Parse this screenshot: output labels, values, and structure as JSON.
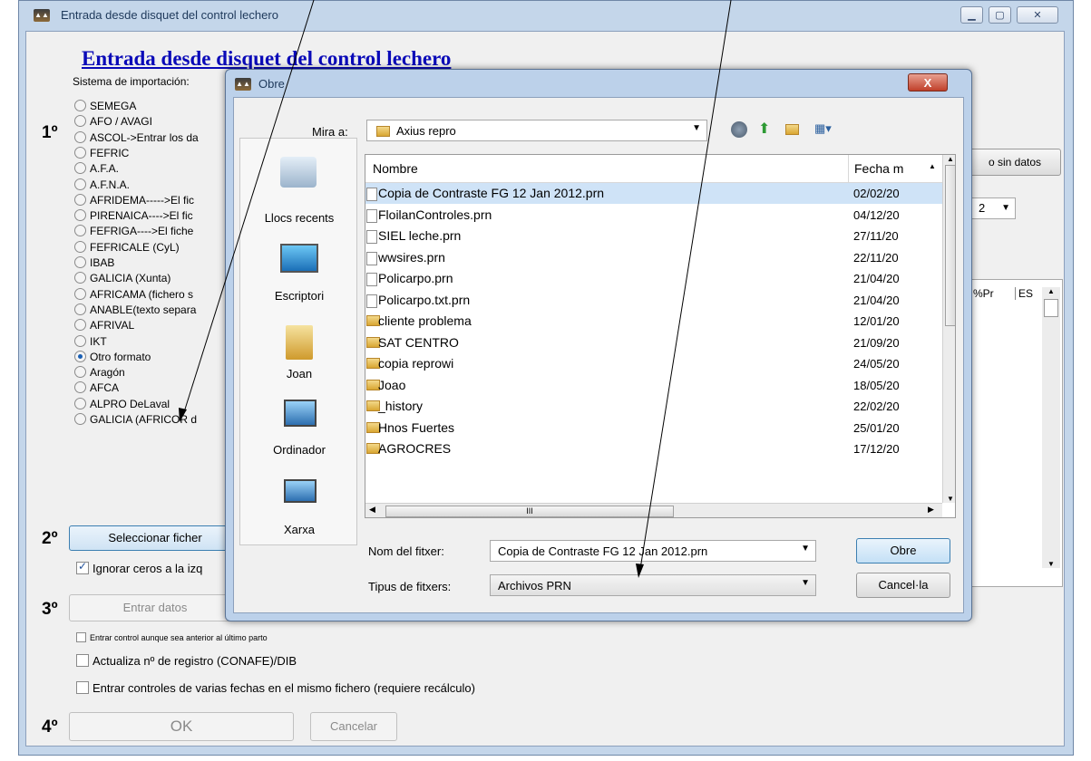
{
  "main_window": {
    "title": "Entrada desde disquet del control lechero",
    "heading": "Entrada desde disquet del control lechero",
    "sistema_label": "Sistema de importación:",
    "options": [
      "SEMEGA",
      "AFO / AVAGI",
      "ASCOL->Entrar los da",
      "FEFRIC",
      "A.F.A.",
      "A.F.N.A.",
      "AFRIDEMA----->El fic",
      "PIRENAICA---->El fic",
      "FEFRIGA---->El fiche",
      "FEFRICALE (CyL)",
      "IBAB",
      "GALICIA (Xunta)",
      "AFRICAMA (fichero s",
      "ANABLE(texto separa",
      "AFRIVAL",
      "IKT",
      "Otro formato",
      "Aragón",
      "AFCA",
      "ALPRO DeLaval",
      "GALICIA (AFRICOR d"
    ],
    "selected_option": "Otro formato",
    "step1": "1º",
    "step2": "2º",
    "step3": "3º",
    "step4": "4º",
    "select_file_button": "Seleccionar ficher",
    "ignore_zeros": "Ignorar ceros a la izq",
    "enter_data_button": "Entrar datos",
    "chk_control_anterior": "Entrar control aunque sea anterior al último parto",
    "chk_actualiza": "Actualiza nº de registro (CONAFE)/DIB",
    "chk_varias_fechas": "Entrar controles de varias fechas en el mismo fichero (requiere recálculo)",
    "ok_button": "OK",
    "cancel_button": "Cancelar",
    "sin_datos_button": "o sin datos",
    "combo_value": "2",
    "col_pr": "%Pr",
    "col_es": "ES"
  },
  "dialog": {
    "title": "Obre",
    "close_label": "X",
    "mira_a_label": "Mira a:",
    "mira_a_value": "Axius repro",
    "places": [
      "Llocs recents",
      "Escriptori",
      "Joan",
      "Ordinador",
      "Xarxa"
    ],
    "col_name": "Nombre",
    "col_date": "Fecha m",
    "files": [
      {
        "name": "Copia de Contraste FG 12 Jan 2012.prn",
        "date": "02/02/20",
        "kind": "file"
      },
      {
        "name": "FloilanControles.prn",
        "date": "04/12/20",
        "kind": "file"
      },
      {
        "name": "SIEL leche.prn",
        "date": "27/11/20",
        "kind": "file"
      },
      {
        "name": "wwsires.prn",
        "date": "22/11/20",
        "kind": "file"
      },
      {
        "name": "Policarpo.prn",
        "date": "21/04/20",
        "kind": "file"
      },
      {
        "name": "Policarpo.txt.prn",
        "date": "21/04/20",
        "kind": "file"
      },
      {
        "name": "cliente problema",
        "date": "12/01/20",
        "kind": "folder"
      },
      {
        "name": "SAT CENTRO",
        "date": "21/09/20",
        "kind": "folder"
      },
      {
        "name": "copia reprowi",
        "date": "24/05/20",
        "kind": "folder"
      },
      {
        "name": "Joao",
        "date": "18/05/20",
        "kind": "folder"
      },
      {
        "name": "_history",
        "date": "22/02/20",
        "kind": "folder"
      },
      {
        "name": "Hnos Fuertes",
        "date": "25/01/20",
        "kind": "folder"
      },
      {
        "name": "AGROCRES",
        "date": "17/12/20",
        "kind": "folder"
      }
    ],
    "hscroll_grip": "III",
    "filename_label": "Nom del fitxer:",
    "filename_value": "Copia de Contraste FG 12 Jan 2012.prn",
    "filetype_label": "Tipus de fitxers:",
    "filetype_value": "Archivos PRN",
    "open_button": "Obre",
    "cancel_button": "Cancel·la"
  },
  "colors": {
    "heading": "#0a0ab8",
    "selection": "#cfe3f7",
    "close": "#c0402a"
  }
}
